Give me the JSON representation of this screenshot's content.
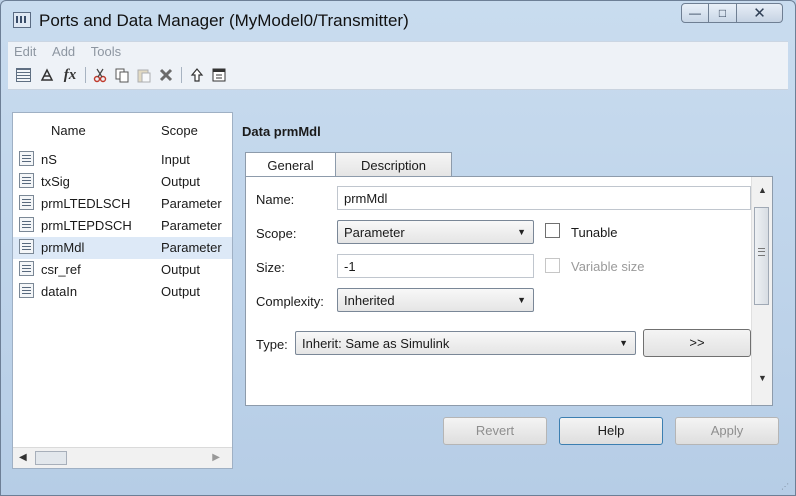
{
  "window": {
    "title": "Ports and Data Manager (MyModel0/Transmitter)",
    "controls": {
      "minimize": "—",
      "maximize": "□",
      "close": "✕"
    }
  },
  "menu": [
    "Edit",
    "Add",
    "Tools"
  ],
  "toolbar": {
    "icons": [
      "add-data-icon",
      "add-input-port-icon",
      "fx-icon",
      "cut-icon",
      "copy-icon",
      "paste-icon",
      "delete-icon",
      "go-up-icon",
      "property-dialog-icon"
    ],
    "fx_label": "fx"
  },
  "left_panel": {
    "headers": {
      "name": "Name",
      "scope": "Scope"
    },
    "rows": [
      {
        "name": "nS",
        "scope": "Input"
      },
      {
        "name": "txSig",
        "scope": "Output"
      },
      {
        "name": "prmLTEDLSCH",
        "scope": "Parameter"
      },
      {
        "name": "prmLTEPDSCH",
        "scope": "Parameter"
      },
      {
        "name": "prmMdl",
        "scope": "Parameter"
      },
      {
        "name": "csr_ref",
        "scope": "Output"
      },
      {
        "name": "dataIn",
        "scope": "Output"
      }
    ],
    "selected_index": 4,
    "scroll": {
      "left": "◀",
      "right": "▶"
    }
  },
  "right_panel": {
    "data_title": "Data prmMdl",
    "tabs": {
      "general": "General",
      "description": "Description"
    },
    "active_tab": "General",
    "fields": {
      "name_label": "Name:",
      "name_value": "prmMdl",
      "scope_label": "Scope:",
      "scope_value": "Parameter",
      "tunable_label": "Tunable",
      "tunable_checked": false,
      "size_label": "Size:",
      "size_value": "-1",
      "variable_size_label": "Variable size",
      "variable_size_checked": false,
      "complexity_label": "Complexity:",
      "complexity_value": "Inherited",
      "type_label": "Type:",
      "type_value": "Inherit: Same as Simulink",
      "type_button": ">>"
    },
    "scroll": {
      "up": "▲",
      "down": "▼"
    }
  },
  "buttons": {
    "revert": "Revert",
    "help": "Help",
    "apply": "Apply"
  },
  "dropdown_arrow": "▼",
  "resize_grip": "⋰"
}
